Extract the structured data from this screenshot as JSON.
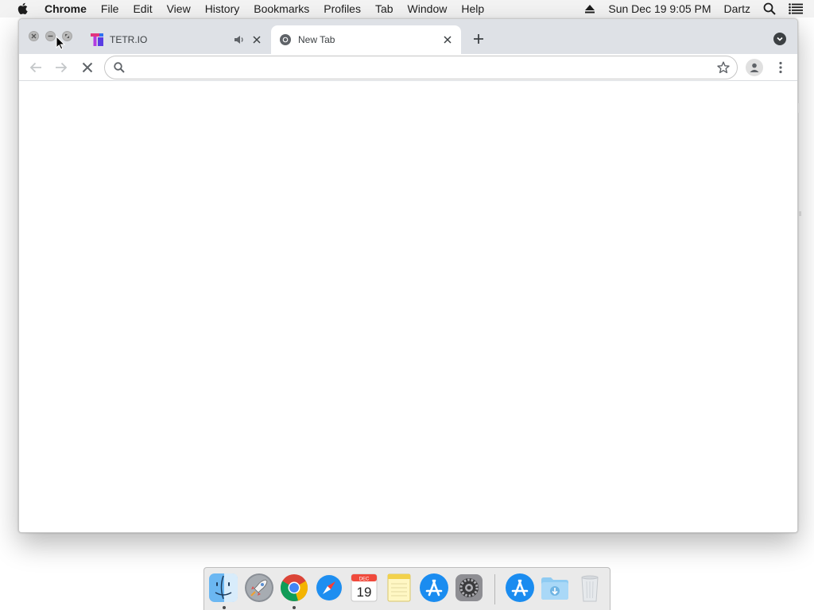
{
  "menubar": {
    "app_name": "Chrome",
    "items": [
      "File",
      "Edit",
      "View",
      "History",
      "Bookmarks",
      "Profiles",
      "Tab",
      "Window",
      "Help"
    ],
    "clock": "Sun Dec 19  9:05 PM",
    "user": "Dartz",
    "icons": [
      "apple-icon",
      "eject-icon",
      "spotlight-search-icon",
      "notification-center-icon"
    ]
  },
  "browser": {
    "tabs": [
      {
        "title": "TETR.IO",
        "favicon": "tetrio-favicon",
        "audio": true,
        "active": false
      },
      {
        "title": "New Tab",
        "favicon": "chrome-favicon",
        "audio": false,
        "active": true
      }
    ],
    "omnibox": {
      "value": "",
      "placeholder": ""
    },
    "loading": true
  },
  "dock": {
    "apps": [
      "Finder",
      "Launchpad",
      "Google Chrome",
      "Safari",
      "Calendar",
      "Notes",
      "App Store",
      "System Preferences",
      "App Store",
      "Downloads",
      "Trash"
    ],
    "calendar": {
      "month": "DEC",
      "day": "19"
    }
  },
  "colors": {
    "tabstrip": "#dee1e6",
    "menubar": "#f3f3f3",
    "icon_gray": "#5f6368",
    "chrome_red": "#db4437",
    "chrome_green": "#0f9d58",
    "chrome_yellow": "#f4b400",
    "chrome_blue": "#4285f4"
  }
}
